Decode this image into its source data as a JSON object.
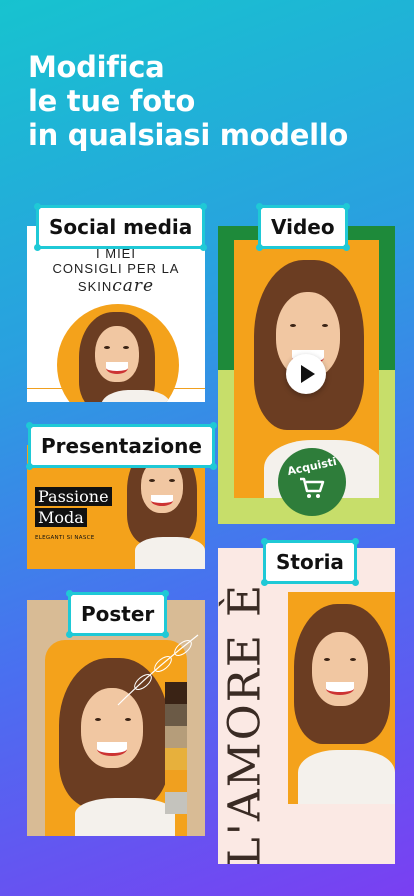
{
  "headline": {
    "line1": "Modifica",
    "line2": "le tue foto",
    "line3": "in qualsiasi modello"
  },
  "templates": {
    "social_media": {
      "label": "Social media",
      "text_line1": "I MIEI",
      "text_line2": "CONSIGLI PER LA",
      "text_line3a": "SKIN",
      "text_line3b": "care"
    },
    "video": {
      "label": "Video",
      "badge": "Acquisti",
      "badge_icon": "cart-icon",
      "play_icon": "play-icon"
    },
    "presentation": {
      "label": "Presentazione",
      "title_line1": "Passione",
      "title_line2": "Moda",
      "subtitle": "ELEGANTI SI NASCE"
    },
    "poster": {
      "label": "Poster",
      "swatches": [
        "#3a2315",
        "#6b5a46",
        "#b59d7a",
        "#e7b03c",
        "#f0a01f",
        "#c4c3bd"
      ]
    },
    "story": {
      "label": "Storia",
      "vertical_text": "L'AMORE È"
    }
  },
  "colors": {
    "accent": "#1fc9d6",
    "orange": "#f4a21b",
    "green_dark": "#1e8a3a",
    "green_light": "#c7de6a",
    "beige": "#d8bb95",
    "pink": "#fbe9e4"
  }
}
